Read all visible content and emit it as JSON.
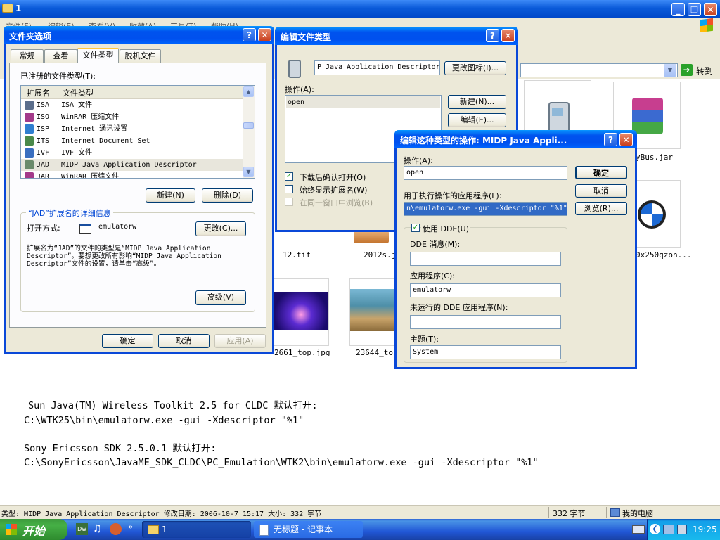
{
  "explorer": {
    "title": "1",
    "menu": [
      "文件(F)",
      "编辑(E)",
      "查看(V)",
      "收藏(A)",
      "工具(T)",
      "帮助(H)"
    ],
    "go_label": "转到",
    "files": [
      {
        "name": "12.tif"
      },
      {
        "name": "2012s.j"
      },
      {
        "name": "yBus.jar"
      },
      {
        "name": "0x250qzon..."
      },
      {
        "name": "2661_top.jpg"
      },
      {
        "name": "23644_top"
      }
    ],
    "status_left": "类型: MIDP Java Application Descriptor 修改日期: 2006-10-7 15:17 大小: 332 字节",
    "status_size": "332 字节",
    "status_location": "我的电脑"
  },
  "folder_options": {
    "title": "文件夹选项",
    "tabs": [
      "常规",
      "查看",
      "文件类型",
      "脱机文件"
    ],
    "registered_label": "已注册的文件类型(T):",
    "columns": [
      "扩展名",
      "文件类型"
    ],
    "rows": [
      {
        "ext": "ISA",
        "type": "ISA 文件",
        "color": "#5b6e8c"
      },
      {
        "ext": "ISO",
        "type": "WinRAR 压缩文件",
        "color": "#a33a8a"
      },
      {
        "ext": "ISP",
        "type": "Internet 通讯设置",
        "color": "#2f7fd0"
      },
      {
        "ext": "ITS",
        "type": "Internet Document Set",
        "color": "#4a8a4a"
      },
      {
        "ext": "IVF",
        "type": "IVF 文件",
        "color": "#3a6fc0"
      },
      {
        "ext": "JAD",
        "type": "MIDP Java Application Descriptor",
        "color": "#6a8a6a"
      },
      {
        "ext": "JAR",
        "type": "WinRAR 压缩文件",
        "color": "#a33a8a"
      }
    ],
    "new_button": "新建(N)",
    "delete_button": "删除(D)",
    "details_title": "“JAD”扩展名的详细信息",
    "open_with_label": "打开方式:",
    "open_with_value": "emulatorw",
    "change_button": "更改(C)...",
    "description": "扩展名为“JAD”的文件的类型是“MIDP Java Application Descriptor”。要想更改所有影响“MIDP Java Application Descriptor”文件的设置，请单击“高级”。",
    "advanced_button": "高级(V)",
    "ok_button": "确定",
    "cancel_button": "取消",
    "apply_button": "应用(A)"
  },
  "edit_file_type": {
    "title": "编辑文件类型",
    "name_value": "P Java Application Descriptor",
    "change_icon_button": "更改图标(I)...",
    "actions_label": "操作(A):",
    "actions": [
      "open"
    ],
    "new_button": "新建(N)...",
    "edit_button": "编辑(E)...",
    "confirm_open_label": "下载后确认打开(O)",
    "confirm_open_checked": true,
    "always_show_ext_label": "始终显示扩展名(W)",
    "always_show_ext_checked": false,
    "browse_same_window_label": "在同一窗口中浏览(B)",
    "browse_same_window_checked": false
  },
  "edit_action": {
    "title": "编辑这种类型的操作: MIDP Java Appli...",
    "action_label": "操作(A):",
    "action_value": "open",
    "app_label": "用于执行操作的应用程序(L):",
    "app_value": "n\\emulatorw.exe -gui -Xdescriptor \"%1\"",
    "ok_button": "确定",
    "cancel_button": "取消",
    "browse_button": "浏览(R)...",
    "use_dde_label": "使用 DDE(U)",
    "use_dde_checked": true,
    "dde_message_label": "DDE 消息(M):",
    "dde_message_value": "",
    "application_label": "应用程序(C):",
    "application_value": "emulatorw",
    "dde_not_running_label": "未运行的 DDE 应用程序(N):",
    "dde_not_running_value": "",
    "topic_label": "主题(T):",
    "topic_value": "System"
  },
  "notes": {
    "line1": "Sun Java(TM) Wireless Toolkit 2.5 for CLDC 默认打开:",
    "line2": "C:\\WTK25\\bin\\emulatorw.exe -gui -Xdescriptor \"%1\"",
    "line3": "Sony Ericsson SDK 2.5.0.1 默认打开:",
    "line4": "C:\\SonyEricsson\\JavaME_SDK_CLDC\\PC_Emulation\\WTK2\\bin\\emulatorw.exe -gui -Xdescriptor \"%1\""
  },
  "taskbar": {
    "start_label": "开始",
    "quicklaunch_icons": [
      "dreamweaver-icon",
      "music-icon",
      "media-icon"
    ],
    "tasks": [
      "1",
      "无标题 - 记事本"
    ],
    "clock": "19:25"
  }
}
